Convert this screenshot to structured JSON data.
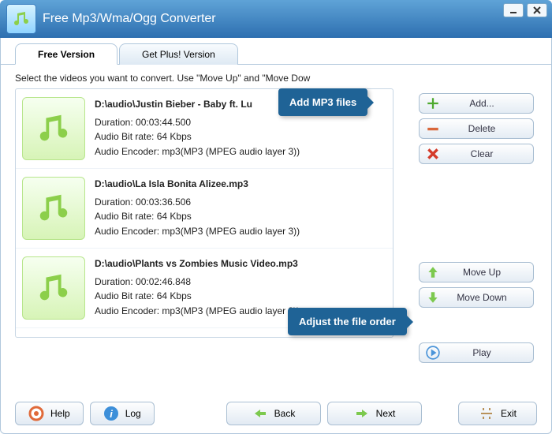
{
  "title": "Free Mp3/Wma/Ogg Converter",
  "tabs": [
    {
      "label": "Free Version",
      "active": true
    },
    {
      "label": "Get Plus! Version",
      "active": false
    }
  ],
  "instruction": "Select the videos you want to convert. Use \"Move Up\" and \"Move Dow",
  "files": [
    {
      "path": "D:\\audio\\Justin Bieber - Baby ft. Lu",
      "duration": "Duration: 00:03:44.500",
      "bitrate": "Audio Bit rate: 64 Kbps",
      "encoder": "Audio Encoder: mp3(MP3 (MPEG audio layer 3))"
    },
    {
      "path": "D:\\audio\\La Isla Bonita Alizee.mp3",
      "duration": "Duration: 00:03:36.506",
      "bitrate": "Audio Bit rate: 64 Kbps",
      "encoder": "Audio Encoder: mp3(MP3 (MPEG audio layer 3))"
    },
    {
      "path": "D:\\audio\\Plants vs Zombies Music Video.mp3",
      "duration": "Duration: 00:02:46.848",
      "bitrate": "Audio Bit rate: 64 Kbps",
      "encoder": "Audio Encoder: mp3(MP3 (MPEG audio layer 3))"
    }
  ],
  "buttons": {
    "add": "Add...",
    "delete": "Delete",
    "clear": "Clear",
    "move_up": "Move Up",
    "move_down": "Move Down",
    "play": "Play",
    "help": "Help",
    "log": "Log",
    "back": "Back",
    "next": "Next",
    "exit": "Exit"
  },
  "callouts": {
    "add_files": "Add MP3 files",
    "adjust_order": "Adjust the file order"
  },
  "colors": {
    "accent": "#1f6396",
    "titlebar_top": "#5fa3d7",
    "titlebar_bottom": "#2d6fb0",
    "icon_green": "#8ccf4b"
  }
}
